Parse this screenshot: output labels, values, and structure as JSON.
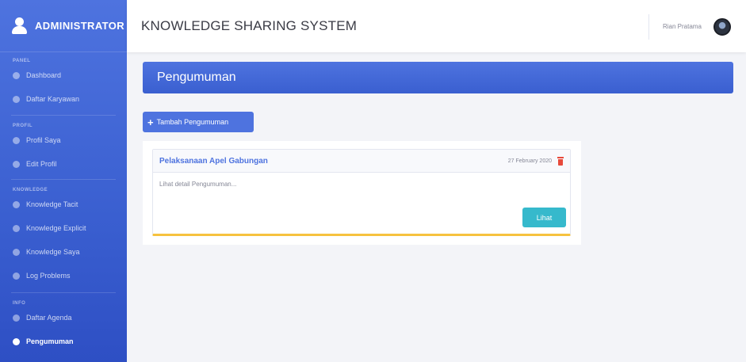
{
  "sidebar": {
    "brand": "ADMINISTRATOR",
    "sections": {
      "s1": "PANEL",
      "s2": "PROFIL",
      "s3": "KNOWLEDGE",
      "s4": "INFO"
    },
    "items": {
      "dashboard": "Dashboard",
      "daftar_karyawan": "Daftar Karyawan",
      "profil_saya": "Profil Saya",
      "edit_profil": "Edit Profil",
      "knowledge_tacit": "Knowledge Tacit",
      "knowledge_explicit": "Knowledge Explicit",
      "knowledge_saya": "Knowledge Saya",
      "log_problems": "Log Problems",
      "daftar_agenda": "Daftar Agenda",
      "pengumuman": "Pengumuman"
    }
  },
  "topbar": {
    "title": "KNOWLEDGE SHARING SYSTEM",
    "user_name": "Rian Pratama"
  },
  "main": {
    "page_title": "Pengumuman",
    "add_button": "Tambah Pengumuman",
    "announcement": {
      "title": "Pelaksanaan Apel Gabungan",
      "date": "27 February 2020",
      "preview": "Lihat detail Pengumuman...",
      "view_button": "Lihat"
    }
  },
  "colors": {
    "primary": "#4e73df",
    "info": "#36b9cc",
    "danger": "#e74a3b",
    "warning": "#f6c23e"
  }
}
